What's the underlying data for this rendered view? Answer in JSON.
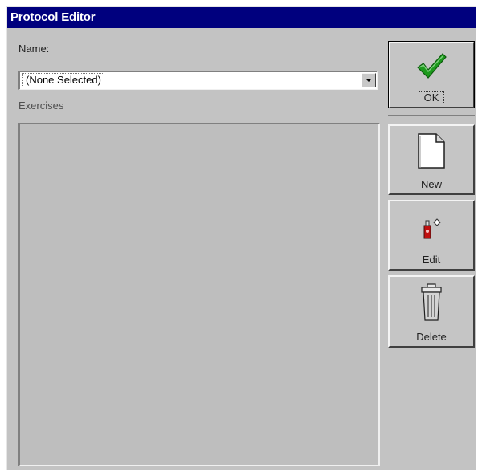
{
  "window": {
    "title": "Protocol Editor"
  },
  "form": {
    "name_label": "Name:",
    "name_value": "(None Selected)",
    "exercises_label": "Exercises"
  },
  "buttons": {
    "ok": {
      "label": "OK",
      "icon": "checkmark-icon"
    },
    "new": {
      "label": "New",
      "icon": "new-document-icon"
    },
    "edit": {
      "label": "Edit",
      "icon": "edit-pencil-icon"
    },
    "delete": {
      "label": "Delete",
      "icon": "trash-can-icon"
    }
  },
  "colors": {
    "title_bar": "#00007e",
    "checkmark": "#1c9a1c",
    "edit_accent": "#c01010"
  }
}
